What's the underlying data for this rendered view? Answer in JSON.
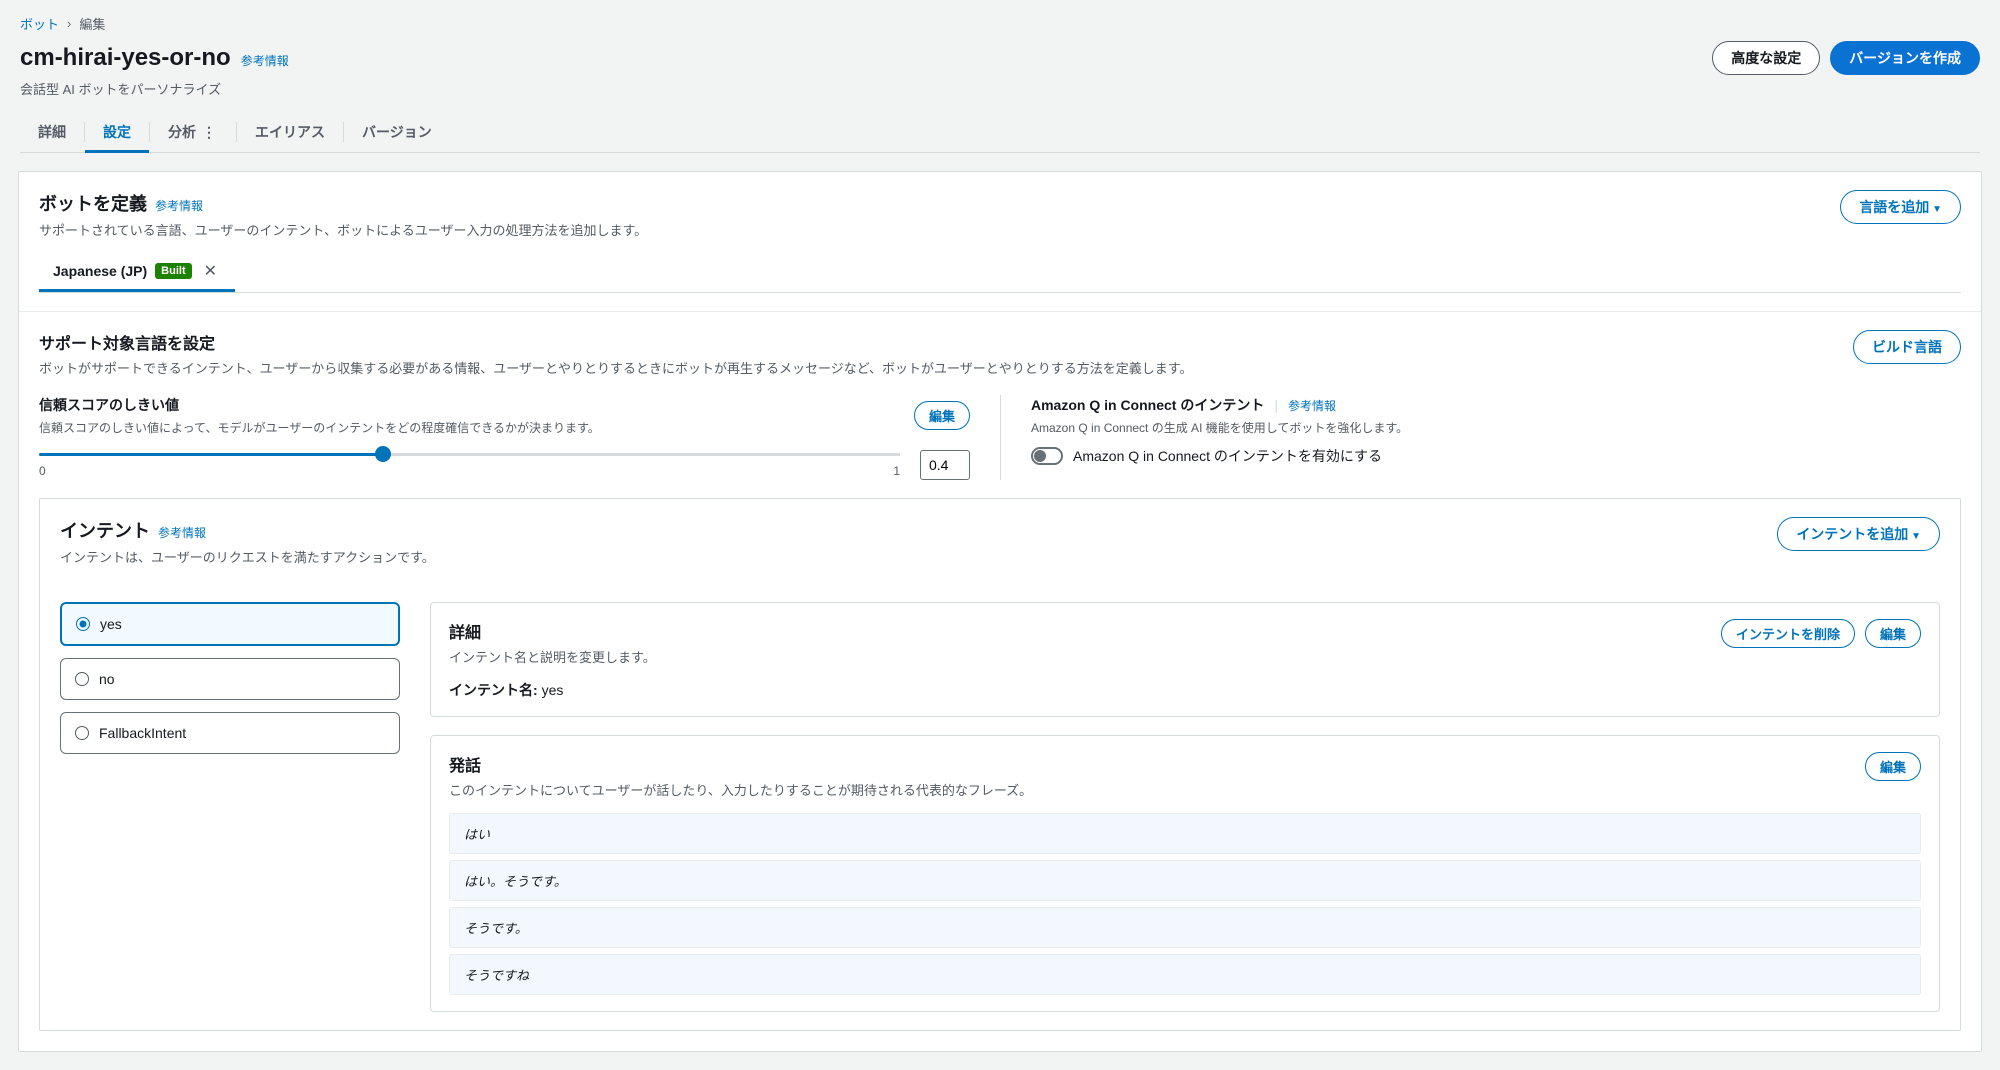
{
  "breadcrumb": {
    "root": "ボット",
    "current": "編集"
  },
  "header": {
    "title": "cm-hirai-yes-or-no",
    "info_link": "参考情報",
    "subtitle": "会話型 AI ボットをパーソナライズ",
    "btn_advanced": "高度な設定",
    "btn_create_version": "バージョンを作成"
  },
  "tabs": {
    "detail": "詳細",
    "settings": "設定",
    "analysis": "分析",
    "alias": "エイリアス",
    "version": "バージョン"
  },
  "define": {
    "title": "ボットを定義",
    "info": "参考情報",
    "desc": "サポートされている言語、ユーザーのインテント、ボットによるユーザー入力の処理方法を追加します。",
    "btn_add_lang": "言語を追加",
    "lang_tab": "Japanese (JP)",
    "lang_badge": "Built"
  },
  "support": {
    "title": "サポート対象言語を設定",
    "desc": "ボットがサポートできるインテント、ユーザーから収集する必要がある情報、ユーザーとやりとりするときにボットが再生するメッセージなど、ボットがユーザーとやりとりする方法を定義します。",
    "btn_build": "ビルド言語"
  },
  "threshold": {
    "label": "信頼スコアのしきい値",
    "desc": "信頼スコアのしきい値によって、モデルがユーザーのインテントをどの程度確信できるかが決まります。",
    "btn_edit": "編集",
    "min": "0",
    "max": "1",
    "value": "0.4"
  },
  "amazonq": {
    "title": "Amazon Q in Connect のインテント",
    "info": "参考情報",
    "desc": "Amazon Q in Connect の生成 AI 機能を使用してボットを強化します。",
    "toggle_label": "Amazon Q in Connect のインテントを有効にする"
  },
  "intent": {
    "title": "インテント",
    "info": "参考情報",
    "desc": "インテントは、ユーザーのリクエストを満たすアクションです。",
    "btn_add": "インテントを追加",
    "items": [
      {
        "name": "yes",
        "selected": true
      },
      {
        "name": "no",
        "selected": false
      },
      {
        "name": "FallbackIntent",
        "selected": false
      }
    ]
  },
  "intent_detail": {
    "section_title": "詳細",
    "section_desc": "インテント名と説明を変更します。",
    "btn_delete": "インテントを削除",
    "btn_edit": "編集",
    "name_label": "インテント名:",
    "name_value": "yes"
  },
  "utterance": {
    "title": "発話",
    "desc": "このインテントについてユーザーが話したり、入力したりすることが期待される代表的なフレーズ。",
    "btn_edit": "編集",
    "items": [
      "はい",
      "はい。そうです。",
      "そうです。",
      "そうですね"
    ]
  }
}
